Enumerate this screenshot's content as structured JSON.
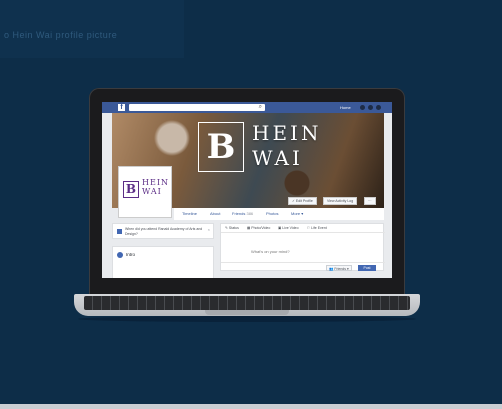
{
  "background": {
    "color": "#0d2d48",
    "banner_text": "o Hein Wai profile picture"
  },
  "facebook": {
    "logo": "f",
    "search": {
      "placeholder": ""
    },
    "nav": {
      "home": "Home",
      "icons": [
        "friends-icon",
        "messages-icon",
        "notifications-icon"
      ]
    },
    "cover": {
      "logo_letter": "B",
      "name_line1": "HEIN",
      "name_line2": "WAI",
      "buttons": [
        "✓ Edit Profile",
        "View Activity Log",
        "···"
      ]
    },
    "profile_picture": {
      "letter": "B",
      "name_line1": "HEIN",
      "name_line2": "WAI"
    },
    "tabs": [
      "Timeline",
      "About",
      "Friends",
      "Photos",
      "More ▾"
    ],
    "friends_count": "386",
    "prompt_card": {
      "text": "When did you attend Ranald Academy of Arts and Design?",
      "close": "×"
    },
    "intro": {
      "label": "Intro"
    },
    "composer": {
      "tabs": [
        "✎ Status",
        "▦ Photo/Video",
        "▣ Live Video",
        "⚐ Life Event"
      ],
      "placeholder": "What's on your mind?",
      "audience": "👥 Friends ▾",
      "post": "Post"
    }
  },
  "colors": {
    "fb_blue": "#3b5998",
    "button_blue": "#4267b2",
    "brand_purple": "#5b2d86"
  }
}
